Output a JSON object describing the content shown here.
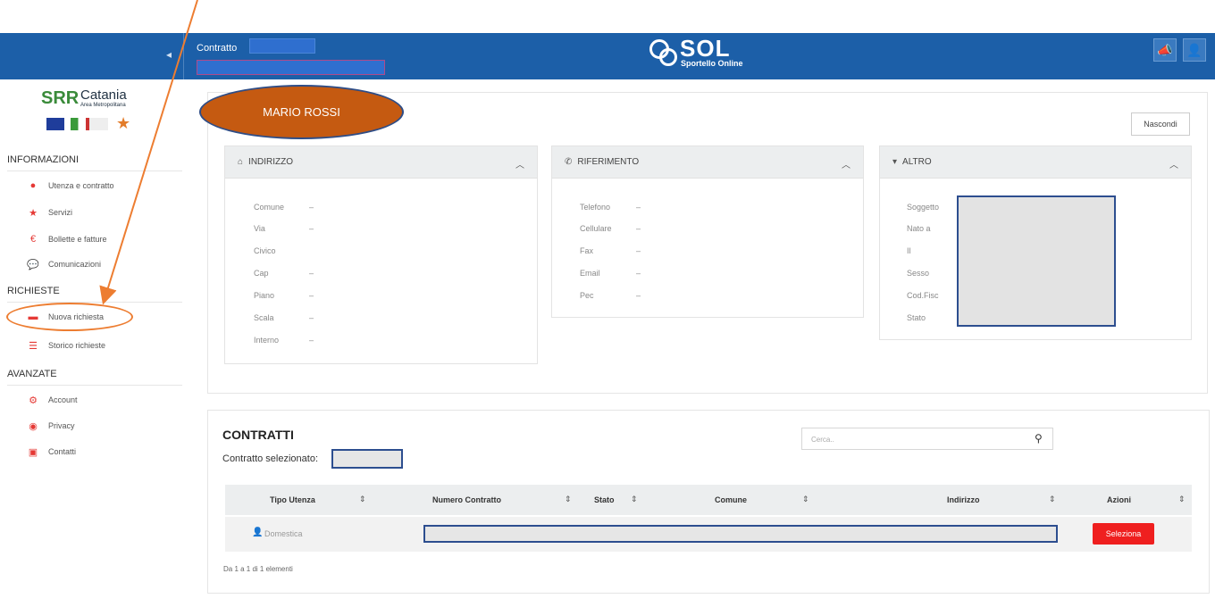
{
  "topbar": {
    "contract_label": "Contratto",
    "logo_word": "SOL",
    "logo_sub": "Sportello Online",
    "collapse_icon": "chevron-left-icon",
    "megaphone_icon": "megaphone-icon",
    "user_icon": "user-icon"
  },
  "sidebar": {
    "brand_srr": "SRR",
    "brand_city": "Catania",
    "brand_area": "Area Metropolitana",
    "sections": [
      {
        "title": "INFORMAZIONI",
        "items": [
          {
            "label": "Utenza e contratto",
            "icon": "user-icon"
          },
          {
            "label": "Servizi",
            "icon": "star-icon"
          },
          {
            "label": "Bollette e fatture",
            "icon": "euro-icon"
          },
          {
            "label": "Comunicazioni",
            "icon": "chat-icon"
          }
        ]
      },
      {
        "title": "RICHIESTE",
        "items": [
          {
            "label": "Nuova richiesta",
            "icon": "ticket-icon"
          },
          {
            "label": "Storico richieste",
            "icon": "list-icon"
          }
        ]
      },
      {
        "title": "AVANZATE",
        "items": [
          {
            "label": "Account",
            "icon": "gears-icon"
          },
          {
            "label": "Privacy",
            "icon": "eye-icon"
          },
          {
            "label": "Contatti",
            "icon": "contact-card-icon"
          }
        ]
      }
    ]
  },
  "annotation": {
    "name_label": "MARIO ROSSI",
    "color": "#c55a11",
    "highlight_color": "#ed7d31"
  },
  "panel": {
    "hide_button": "Nascondi",
    "cards": {
      "indirizzo": {
        "title": "INDIRIZZO",
        "fields": [
          {
            "label": "Comune",
            "value": "–"
          },
          {
            "label": "Via",
            "value": "–"
          },
          {
            "label": "Civico",
            "value": ""
          },
          {
            "label": "Cap",
            "value": "–"
          },
          {
            "label": "Piano",
            "value": "–"
          },
          {
            "label": "Scala",
            "value": "–"
          },
          {
            "label": "Interno",
            "value": "–"
          }
        ]
      },
      "riferimento": {
        "title": "RIFERIMENTO",
        "fields": [
          {
            "label": "Telefono",
            "value": "–"
          },
          {
            "label": "Cellulare",
            "value": "–"
          },
          {
            "label": "Fax",
            "value": "–"
          },
          {
            "label": "Email",
            "value": "–"
          },
          {
            "label": "Pec",
            "value": "–"
          }
        ]
      },
      "altro": {
        "title": "ALTRO",
        "fields": [
          {
            "label": "Soggetto"
          },
          {
            "label": "Nato a"
          },
          {
            "label": "Il"
          },
          {
            "label": "Sesso"
          },
          {
            "label": "Cod.Fisc"
          },
          {
            "label": "Stato"
          }
        ]
      }
    }
  },
  "contratti": {
    "title": "CONTRATTI",
    "selected_label": "Contratto selezionato:",
    "search_placeholder": "Cerca..",
    "columns": [
      "Tipo Utenza",
      "Numero Contratto",
      "Stato",
      "Comune",
      "Indirizzo",
      "Azioni"
    ],
    "rows": [
      {
        "tipo": "Domestica",
        "action": "Seleziona"
      }
    ],
    "footer": "Da 1 a 1 di 1 elementi"
  }
}
